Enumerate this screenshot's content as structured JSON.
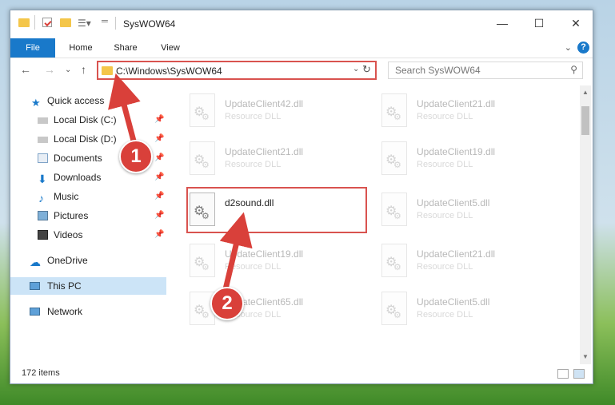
{
  "window": {
    "title": "SysWOW64"
  },
  "ribbon": {
    "tabs": [
      "File",
      "Home",
      "Share",
      "View"
    ],
    "help_label": "?"
  },
  "address": {
    "path": "C:\\Windows\\SysWOW64"
  },
  "search": {
    "placeholder": "Search SysWOW64"
  },
  "nav": {
    "items": [
      {
        "label": "Quick access",
        "icon": "star-icon"
      },
      {
        "label": "Local Disk (C:)",
        "icon": "drive-icon"
      },
      {
        "label": "Local Disk (D:)",
        "icon": "drive-icon"
      },
      {
        "label": "Documents",
        "icon": "documents-icon"
      },
      {
        "label": "Downloads",
        "icon": "download-icon"
      },
      {
        "label": "Music",
        "icon": "music-icon"
      },
      {
        "label": "Pictures",
        "icon": "pictures-icon"
      },
      {
        "label": "Videos",
        "icon": "videos-icon"
      },
      {
        "label": "OneDrive",
        "icon": "cloud-icon"
      },
      {
        "label": "This PC",
        "icon": "computer-icon"
      },
      {
        "label": "Network",
        "icon": "network-icon"
      }
    ]
  },
  "files": [
    {
      "name": "UpdateClient42.dll",
      "type": "Resource DLL"
    },
    {
      "name": "UpdateClient21.dll",
      "type": "Resource DLL"
    },
    {
      "name": "UpdateClient21.dll",
      "type": "Resource DLL"
    },
    {
      "name": "UpdateClient19.dll",
      "type": "Resource DLL"
    },
    {
      "name": "d2sound.dll",
      "type": ""
    },
    {
      "name": "UpdateClient5.dll",
      "type": "Resource DLL"
    },
    {
      "name": "UpdateClient19.dll",
      "type": "Resource DLL"
    },
    {
      "name": "UpdateClient21.dll",
      "type": "Resource DLL"
    },
    {
      "name": "UpdateClient65.dll",
      "type": "Resource DLL"
    },
    {
      "name": "UpdateClient5.dll",
      "type": "Resource DLL"
    }
  ],
  "status": {
    "item_count": "172 items"
  },
  "callouts": [
    "1",
    "2"
  ],
  "colors": {
    "accent": "#1979ca",
    "highlight_red": "#d9534f"
  }
}
